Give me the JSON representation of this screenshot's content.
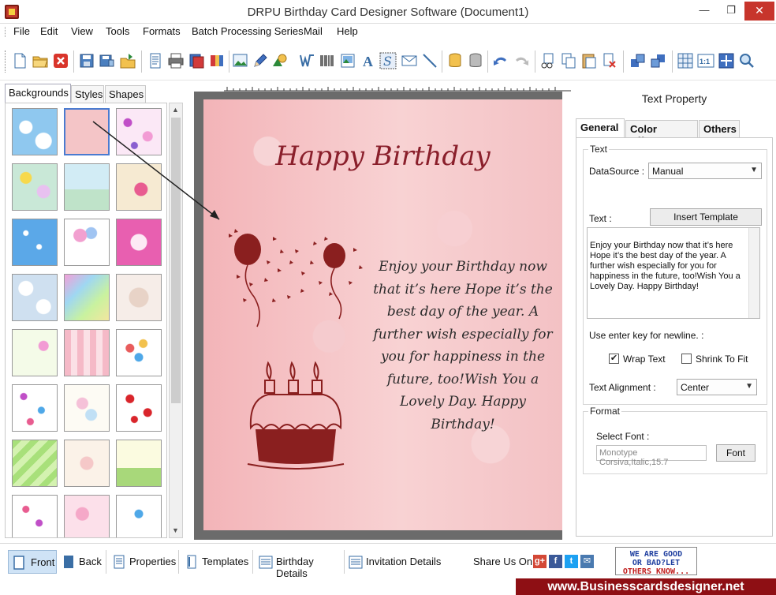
{
  "window": {
    "title": "DRPU Birthday Card Designer Software (Document1)",
    "minimize_glyph": "—",
    "maximize_glyph": "❐",
    "close_glyph": "✕"
  },
  "menu": {
    "items": [
      "File",
      "Edit",
      "View",
      "Tools",
      "Formats",
      "Batch Processing Series",
      "Mail",
      "Help"
    ]
  },
  "left_panel": {
    "tabs": [
      "Backgrounds",
      "Styles",
      "Shapes"
    ],
    "active_tab": "Backgrounds",
    "scroll_up": "▲",
    "scroll_down": "▼"
  },
  "card": {
    "title": "Happy Birthday",
    "body": "Enjoy your Birthday now\nthat it’s here Hope it’s the\nbest day of the year. A\nfurther wish especially for\nyou for happiness in the\nfuture, too!Wish You a\nLovely Day. Happy\nBirthday!"
  },
  "right_panel": {
    "title": "Text Property",
    "tabs": [
      "General",
      "Color Effects",
      "Others"
    ],
    "active_tab": "General",
    "text_group": {
      "legend": "Text",
      "datasource_label": "DataSource :",
      "datasource_value": "Manual",
      "text_label": "Text :",
      "insert_template_label": "Insert Template",
      "text_value": "Enjoy your Birthday now that it’s here\nHope it’s the best day of the year. A\nfurther wish especially for you for\nhappiness in the future, too!Wish You a\nLovely Day. Happy Birthday!",
      "newline_hint": "Use enter key for newline. :",
      "wrap_text_label": "Wrap Text",
      "wrap_text_checked": true,
      "wrap_check_glyph": "✔",
      "shrink_to_fit_label": "Shrink To Fit",
      "shrink_to_fit_checked": false,
      "alignment_label": "Text Alignment :",
      "alignment_value": "Center"
    },
    "format_group": {
      "legend": "Format",
      "select_font_label": "Select Font :",
      "font_value": "Monotype Corsiva,Italic,15.7",
      "font_button_label": "Font"
    }
  },
  "bottom_bar": {
    "items": [
      "Front",
      "Back",
      "Properties",
      "Templates",
      "Birthday Details",
      "Invitation Details"
    ],
    "active_item": "Front",
    "share_label": "Share Us On :",
    "social": [
      "g+",
      "f",
      "t",
      "✉"
    ],
    "feedback_badge": {
      "line1": "WE ARE GOOD",
      "line2": "OR BAD?LET",
      "line3": "OTHERS KNOW..."
    }
  },
  "footer": {
    "url": "www.Businesscardsdesigner.net"
  },
  "colors": {
    "card_title": "#8a1f2b",
    "card_bg": "#f2b9bd",
    "footer_bg": "#8e0f14",
    "active_tab_bg": "#cfe3f6",
    "close_button": "#c7352c"
  }
}
